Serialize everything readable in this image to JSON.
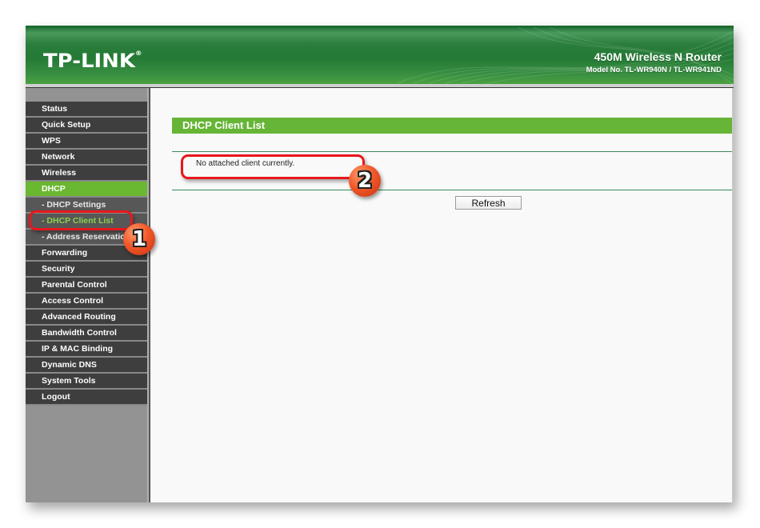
{
  "header": {
    "logo": "TP-LINK",
    "logo_mark": "®",
    "product_name": "450M Wireless N Router",
    "model": "Model No. TL-WR940N / TL-WR941ND"
  },
  "sidebar": {
    "items": [
      {
        "label": "Status"
      },
      {
        "label": "Quick Setup"
      },
      {
        "label": "WPS"
      },
      {
        "label": "Network"
      },
      {
        "label": "Wireless"
      },
      {
        "label": "DHCP",
        "active": true
      },
      {
        "label": "- DHCP Settings"
      },
      {
        "label": "- DHCP Client List",
        "current": true
      },
      {
        "label": "- Address Reservation"
      },
      {
        "label": "Forwarding"
      },
      {
        "label": "Security"
      },
      {
        "label": "Parental Control"
      },
      {
        "label": "Access Control"
      },
      {
        "label": "Advanced Routing"
      },
      {
        "label": "Bandwidth Control"
      },
      {
        "label": "IP & MAC Binding"
      },
      {
        "label": "Dynamic DNS"
      },
      {
        "label": "System Tools"
      },
      {
        "label": "Logout"
      }
    ]
  },
  "main": {
    "title": "DHCP Client List",
    "message": "No attached client currently.",
    "refresh_label": "Refresh"
  },
  "annotations": {
    "badge1": "1",
    "badge2": "2"
  },
  "colors": {
    "header_green": "#247a35",
    "accent_green": "#66b536",
    "menu_bg": "#3e3e3e",
    "annotation_red": "#e8171b"
  }
}
